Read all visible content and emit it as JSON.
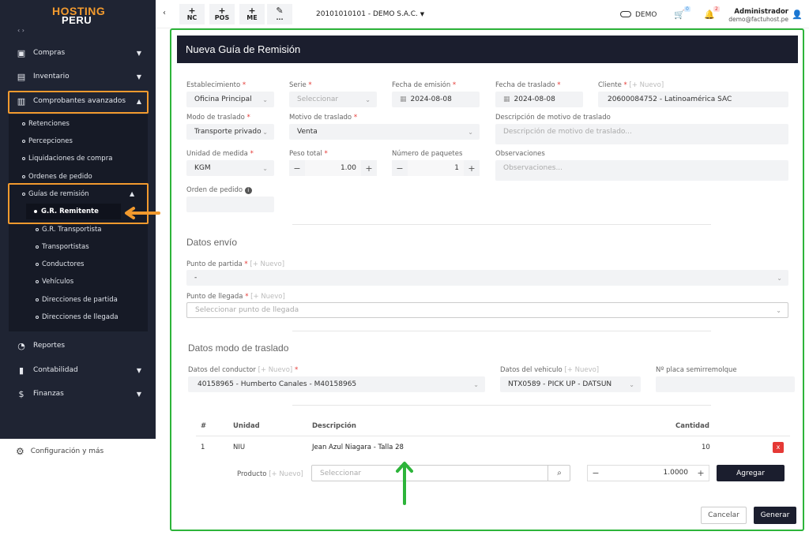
{
  "sidebar": {
    "logo_top": "HOSTING",
    "logo_bottom": "PERU",
    "items": [
      {
        "label": "Compras"
      },
      {
        "label": "Inventario"
      },
      {
        "label": "Comprobantes avanzados"
      },
      {
        "label": "Reportes"
      },
      {
        "label": "Contabilidad"
      },
      {
        "label": "Finanzas"
      }
    ],
    "sub": [
      "Retenciones",
      "Percepciones",
      "Liquidaciones de compra",
      "Ordenes de pedido"
    ],
    "guias": "Guías de remisión",
    "guias_sub": [
      "G.R. Remitente",
      "G.R. Transportista",
      "Transportistas",
      "Conductores",
      "Vehículos",
      "Direcciones de partida",
      "Direcciones de llegada"
    ],
    "config": "Configuración y más"
  },
  "topbar": {
    "nc": "NC",
    "pos": "POS",
    "me": "ME",
    "more": "...",
    "company": "20101010101 - DEMO S.A.C.",
    "demo": "DEMO",
    "cart_badge": "0",
    "bell_badge": "2",
    "user": "Administrador",
    "email": "demo@factuhost.pe"
  },
  "form": {
    "title": "Nueva Guía de Remisión",
    "establecimiento_label": "Establecimiento",
    "establecimiento": "Oficina Principal",
    "serie_label": "Serie",
    "serie_ph": "Seleccionar",
    "fecha_emision_label": "Fecha de emisión",
    "fecha_emision": "2024-08-08",
    "fecha_traslado_label": "Fecha de traslado",
    "fecha_traslado": "2024-08-08",
    "cliente_label": "Cliente",
    "nuevo": "[+ Nuevo]",
    "cliente": "20600084752 - Latinoamérica SAC",
    "modo_label": "Modo de traslado",
    "modo": "Transporte privado",
    "motivo_label": "Motivo de traslado",
    "motivo": "Venta",
    "desc_motivo_label": "Descripción de motivo de traslado",
    "desc_motivo_ph": "Descripción de motivo de traslado...",
    "unidad_label": "Unidad de medida",
    "unidad": "KGM",
    "peso_label": "Peso total",
    "peso": "1.00",
    "paquetes_label": "Número de paquetes",
    "paquetes": "1",
    "obs_label": "Observaciones",
    "obs_ph": "Observaciones...",
    "orden_label": "Orden de pedido",
    "datos_envio": "Datos envío",
    "partida_label": "Punto de partida",
    "partida": "-",
    "llegada_label": "Punto de llegada",
    "llegada_ph": "Seleccionar punto de llegada",
    "datos_modo": "Datos modo de traslado",
    "conductor_label": "Datos del conductor",
    "conductor": "40158965 - Humberto Canales - M40158965",
    "vehiculo_label": "Datos del vehiculo",
    "vehiculo": "NTX0589 - PICK UP - DATSUN",
    "placa_label": "Nº placa semirremolque",
    "table": {
      "headers": [
        "#",
        "Unidad",
        "Descripción",
        "Cantidad"
      ],
      "row": [
        "1",
        "NIU",
        "Jean Azul Niagara - Talla 28",
        "10"
      ]
    },
    "producto_label": "Producto",
    "producto_ph": "Seleccionar",
    "cantidad": "1.0000",
    "agregar": "Agregar",
    "cancelar": "Cancelar",
    "generar": "Generar",
    "delete": "x"
  }
}
